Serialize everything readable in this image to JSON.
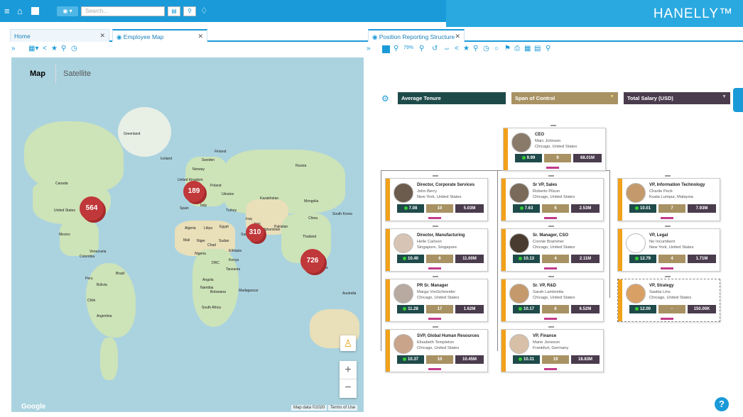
{
  "app": {
    "brand": "HANELLY™",
    "search_placeholder": "Search..."
  },
  "left_panel": {
    "tabs": [
      {
        "label": "Home"
      },
      {
        "label": "Employee Map"
      }
    ],
    "map_type_buttons": [
      "Map",
      "Satellite"
    ],
    "clusters": [
      {
        "label": "564"
      },
      {
        "label": "189"
      },
      {
        "label": "310"
      },
      {
        "label": "726"
      }
    ],
    "map_labels": {
      "greenland": "Greenland",
      "iceland": "Iceland",
      "finland": "Finland",
      "sweden": "Sweden",
      "norway": "Norway",
      "russia": "Russia",
      "uk": "United Kingdom",
      "poland": "Poland",
      "ukraine": "Ukraine",
      "kazakhstan": "Kazakhstan",
      "mongolia": "Mongolia",
      "canada": "Canada",
      "us": "United States",
      "mexico": "Mexico",
      "spain": "Spain",
      "italy": "Italy",
      "turkey": "Turkey",
      "china": "China",
      "south_korea": "South Korea",
      "iraq": "Iraq",
      "iran": "Iran",
      "afghanistan": "Afghanistan",
      "pakistan": "Pakistan",
      "algeria": "Algeria",
      "libya": "Libya",
      "egypt": "Egypt",
      "saudi": "Saudi Arabia",
      "thailand": "Thailand",
      "mali": "Mali",
      "niger": "Niger",
      "chad": "Chad",
      "sudan": "Sudan",
      "ethiopia": "Ethiopia",
      "nigeria": "Nigeria",
      "venezuela": "Venezuela",
      "colombia": "Colombia",
      "drc": "DRC",
      "kenya": "Kenya",
      "tanzania": "Tanzania",
      "indonesia": "Indonesia",
      "brazil": "Brazil",
      "peru": "Peru",
      "bolivia": "Bolivia",
      "angola": "Angola",
      "namibia": "Namibia",
      "botswana": "Botswana",
      "madagascar": "Madagascar",
      "chile": "Chile",
      "australia": "Australia",
      "south_africa": "South Africa",
      "argentina": "Argentina"
    },
    "footer": {
      "logo": "Google",
      "data": "Map data ©2020",
      "terms": "Terms of Use"
    }
  },
  "right_panel": {
    "tab": "Position Reporting Structure",
    "zoom_label": "79%",
    "dropdowns": [
      "Average Tenure",
      "Span of Control",
      "Total Salary (USD)"
    ],
    "cards": [
      {
        "title": "CEO",
        "name": "Marc Johnson",
        "location": "Chicago, United States",
        "m1": "9.99",
        "m2": "9",
        "m3": "68.01M"
      },
      {
        "title": "Director, Corporate Services",
        "name": "John Berry",
        "location": "New York, United States",
        "m1": "7.08",
        "m2": "10",
        "m3": "5.03M"
      },
      {
        "title": "Sr VP, Sales",
        "name": "Roberto Pilson",
        "location": "Chicago, United States",
        "m1": "7.63",
        "m2": "6",
        "m3": "2.53M"
      },
      {
        "title": "VP, Information Technology",
        "name": "Charlie Peck",
        "location": "Kuala Lumpur, Malaysia",
        "m1": "10.01",
        "m2": "7",
        "m3": "7.93M"
      },
      {
        "title": "Director, Manufacturing",
        "name": "Helle Carlson",
        "location": "Singapore, Singapore",
        "m1": "10.40",
        "m2": "6",
        "m3": "11.00M"
      },
      {
        "title": "Sr. Manager, CSO",
        "name": "Connie Brammer",
        "location": "Chicago, United States",
        "m1": "10.13",
        "m2": "4",
        "m3": "2.11M"
      },
      {
        "title": "VP, Legal",
        "name": "No Incumbent",
        "location": "New York, United States",
        "m1": "12.79",
        "m2": "4",
        "m3": "1.71M"
      },
      {
        "title": "PR Sr. Manager",
        "name": "Marga VonSchneider",
        "location": "Chicago, United States",
        "m1": "11.28",
        "m2": "17",
        "m3": "1.62M"
      },
      {
        "title": "Sr. VP, R&D",
        "name": "Sarah Lambretta",
        "location": "Chicago, United States",
        "m1": "10.17",
        "m2": "6",
        "m3": "6.52M"
      },
      {
        "title": "VP, Strategy",
        "name": "Saskia Lins",
        "location": "Chicago, United States",
        "m1": "12.00",
        "m2": "-",
        "m3": "150.00K"
      },
      {
        "title": "SVP, Global Human Resources",
        "name": "Elisabeth Templeton",
        "location": "Chicago, United States",
        "m1": "10.37",
        "m2": "10",
        "m3": "10.45M"
      },
      {
        "title": "VP, Finance",
        "name": "Marie Joneson",
        "location": "Frankfurt, Germany",
        "m1": "10.31",
        "m2": "19",
        "m3": "18.83M"
      }
    ]
  }
}
